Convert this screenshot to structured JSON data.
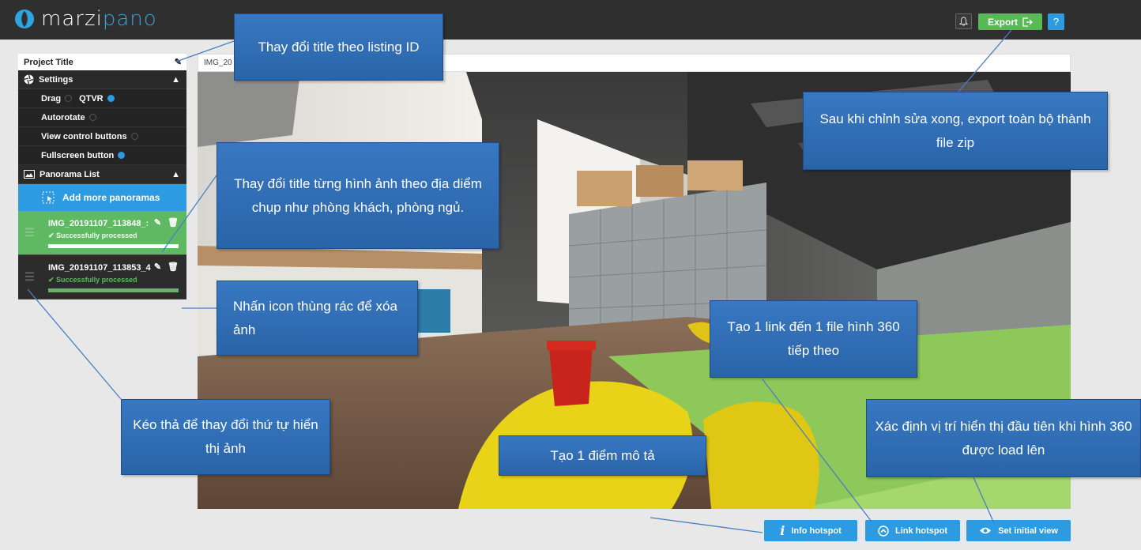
{
  "app": {
    "logo_main": "marzi",
    "logo_accent": "pano",
    "export_label": "Export",
    "help_label": "?"
  },
  "sidebar": {
    "project_title": "Project Title",
    "settings_label": "Settings",
    "settings": [
      {
        "label": "Drag",
        "on": false
      },
      {
        "label": "QTVR",
        "on": true
      },
      {
        "label": "Autorotate",
        "on": false
      },
      {
        "label": "View control buttons",
        "on": false
      },
      {
        "label": "Fullscreen button",
        "on": true
      }
    ],
    "panorama_list_label": "Panorama List",
    "add_more_label": "Add more panoramas",
    "panoramas": [
      {
        "name": "IMG_20191107_113848_:",
        "status": "✔ Successfully processed",
        "progress": 1.0
      },
      {
        "name": "IMG_20191107_113853_4",
        "status": "✔ Successfully processed",
        "progress": 1.0
      }
    ]
  },
  "viewer": {
    "title": "IMG_20"
  },
  "buttons": {
    "info_hotspot": "Info hotspot",
    "link_hotspot": "Link hotspot",
    "set_initial_view": "Set initial view"
  },
  "callouts": {
    "title_listing": "Thay đổi title theo listing ID",
    "export_zip": "Sau khi chỉnh sửa xong, export toàn bộ thành file zip",
    "image_title": "Thay đổi title từng hình ảnh theo địa diểm chụp như phòng khách, phòng ngủ.",
    "trash": "Nhấn icon thùng rác để xóa ảnh",
    "link_next": "Tạo 1 link đến 1 file hình 360 tiếp theo",
    "drag_order": "Kéo thả để thay đổi thứ tự hiển thị ảnh",
    "initial_view": "Xác định vị trí hiển thị đầu tiên khi hình 360 được load lên",
    "info_point": "Tạo 1 điểm mô tả"
  },
  "colors": {
    "accent_blue": "#2c9be1",
    "success_green": "#5fb862",
    "callout_blue": "#2d6db7",
    "topbar": "#2f2f2f"
  }
}
